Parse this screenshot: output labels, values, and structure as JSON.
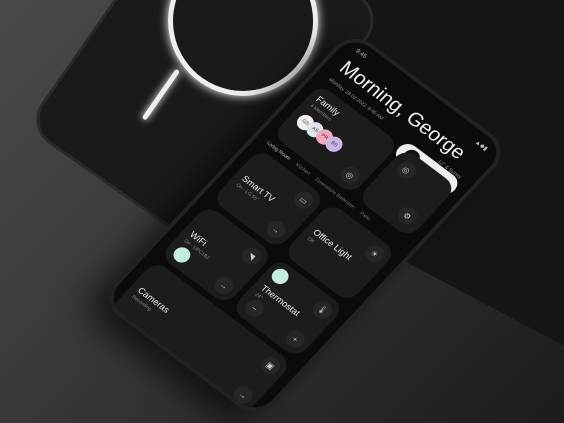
{
  "status": {
    "time": "9:45",
    "signal_icon": "signal-wifi-battery-icon"
  },
  "greeting": "Morning, George",
  "weather": "12° & Sunny",
  "date": "Monday, 28.03.2022, 9:45 AM",
  "family": {
    "title": "Family",
    "subtitle": "4 Members",
    "members": [
      {
        "initials": "GS",
        "color": "#f2f2f2"
      },
      {
        "initials": "AS",
        "color": "#dfe3ee"
      },
      {
        "initials": "PR",
        "color": "#f0a9bd"
      },
      {
        "initials": "BS",
        "color": "#c9b5e8"
      }
    ]
  },
  "tabs": [
    "Living Room",
    "Kitchen",
    "Downstairs Bathroom",
    "Patio"
  ],
  "devices": {
    "smart_tv": {
      "title": "Smart TV",
      "subtitle": "On · LG 55\""
    },
    "office_light": {
      "title": "Office Light",
      "subtitle": "Off"
    },
    "wifi": {
      "title": "WiFi",
      "subtitle": "On · UPC182"
    },
    "thermostat": {
      "title": "Thermostat",
      "subtitle": "24°",
      "minus": "−",
      "plus": "+"
    },
    "cameras": {
      "title": "Cameras",
      "subtitle": "Recording"
    }
  },
  "accent": "#c5ece0"
}
